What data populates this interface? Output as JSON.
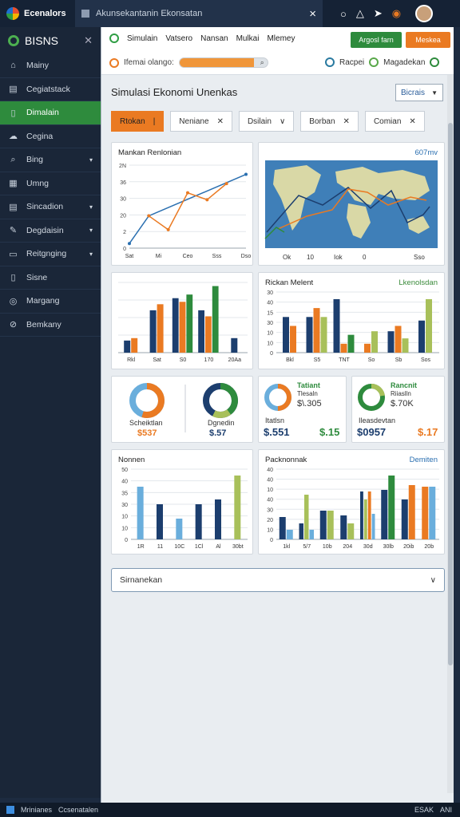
{
  "window": {
    "app_name": "Ecenalors",
    "tab_title": "Akunsekantanin Ekonsatan",
    "close": "×",
    "controls": [
      "⚪",
      "⚠",
      "➤",
      "●"
    ]
  },
  "sidebar": {
    "brand": "BISNS",
    "items": [
      {
        "label": "Mainy",
        "icon": "window-icon",
        "glyph": "⌂",
        "chev": ""
      },
      {
        "label": "Cegiatstack",
        "icon": "table-icon",
        "glyph": "▤",
        "chev": ""
      },
      {
        "label": "Dimalain",
        "icon": "book-icon",
        "glyph": "▯",
        "chev": "",
        "active": true
      },
      {
        "label": "Cegina",
        "icon": "cloud-icon",
        "glyph": "☁",
        "chev": ""
      },
      {
        "label": "Bing",
        "icon": "search-icon",
        "glyph": "⌕",
        "chev": "▾"
      },
      {
        "label": "Umng",
        "icon": "calendar-icon",
        "glyph": "▦",
        "chev": ""
      },
      {
        "label": "Sincadion",
        "icon": "doc-icon",
        "glyph": "▤",
        "chev": "▾"
      },
      {
        "label": "Degdaisin",
        "icon": "pen-icon",
        "glyph": "✎",
        "chev": "▾"
      },
      {
        "label": "Reitgnging",
        "icon": "folder-icon",
        "glyph": "▭",
        "chev": "▾"
      },
      {
        "label": "Sisne",
        "icon": "file-icon",
        "glyph": "▯",
        "chev": ""
      },
      {
        "label": "Margang",
        "icon": "globe-icon",
        "glyph": "◎",
        "chev": ""
      },
      {
        "label": "Bemkany",
        "icon": "check-circle-icon",
        "glyph": "⊘",
        "chev": ""
      }
    ]
  },
  "topbar": {
    "links": [
      "Simulain",
      "Vatsero",
      "Nansan",
      "Mulkai",
      "Mlemey"
    ],
    "btn_green": "Argosl farn",
    "btn_orange": "Meskea",
    "status_label": "Ifemai olango:",
    "progress": 0.85,
    "right_labels": [
      "Racpei",
      "Magadekan"
    ]
  },
  "page": {
    "title": "Simulasi Ekonomi Unenkas",
    "select": "Bicrais"
  },
  "filters": [
    {
      "label": "Rtokan",
      "mark": "|",
      "active": true
    },
    {
      "label": "Neniane",
      "mark": "✕"
    },
    {
      "label": "Dsilain",
      "mark": "∨"
    },
    {
      "label": "Borban",
      "mark": "✕"
    },
    {
      "label": "Comian",
      "mark": "✕"
    }
  ],
  "cards": {
    "line_title": "Mankan Renlonian",
    "map_label": "607mv",
    "bars1_title": "",
    "bars2_title": "Rickan Melent",
    "bars2_right": "Lkenolsdan",
    "donut1_label": "Scheiktlan",
    "donut1_value": "$537",
    "donut2_label": "Dgnedin",
    "donut2_value": "$.57",
    "donut3_title": "Tatiant",
    "donut3_sub": "Tlesaln",
    "donut3_amount": "$\\.305",
    "donut3_label": "Itatlsn",
    "donut3_value_a": "$.551",
    "donut3_value_b": "$.15",
    "donut4_title": "Rancnit",
    "donut4_sub": "Riiaslln",
    "donut4_amount": "$.70K",
    "donut4_label": "Ileasdevtan",
    "donut4_value_a": "$0957",
    "donut4_value_b": "$.17",
    "bars3_title": "Nonnen",
    "bars4_title": "Packnonnak",
    "bars4_right": "Demiten"
  },
  "accordion": "Sirnanekan",
  "taskbar": [
    "Mrinianes",
    "Ccsenatalen",
    "ESAK",
    "ANI"
  ],
  "colors": {
    "green": "#2e8b3d",
    "orange": "#ea7a22",
    "navy": "#1c3e6e",
    "sky": "#6aaedc",
    "olive": "#a8c05a"
  },
  "chart_data": [
    {
      "type": "line",
      "title": "Mankan Renlonian",
      "categories": [
        "Sat",
        "Mi",
        "Ceo",
        "Sss",
        "Dso"
      ],
      "yticks": [
        "0",
        "2",
        "20",
        "30",
        "36",
        "2N"
      ],
      "series": [
        {
          "color": "#2a6fb0",
          "values": [
            2,
            14,
            null,
            null,
            null,
            null,
            32
          ]
        },
        {
          "color": "#ea7a22",
          "values": [
            null,
            14,
            8,
            24,
            21,
            28,
            null
          ]
        }
      ]
    },
    {
      "type": "bar",
      "categories": [
        "Rkl",
        "Sat",
        "S0",
        "170",
        "20Aa"
      ],
      "series": [
        {
          "color": "#1c3e6e",
          "values": [
            10,
            35,
            45,
            35,
            12
          ]
        },
        {
          "color": "#ea7a22",
          "values": [
            12,
            40,
            42,
            30,
            0
          ]
        },
        {
          "color": "#2e8b3d",
          "values": [
            0,
            0,
            48,
            55,
            0
          ]
        }
      ]
    },
    {
      "type": "bar",
      "title": "Rickan Melent",
      "categories": [
        "Bkl",
        "S5",
        "TNT",
        "So",
        "Sb",
        "Sos"
      ],
      "yticks": [
        "0",
        "10",
        "10",
        "30",
        "15",
        "40",
        "30"
      ],
      "series": [
        {
          "color": "#1c3e6e",
          "values": [
            20,
            20,
            30,
            0,
            12,
            18
          ]
        },
        {
          "color": "#ea7a22",
          "values": [
            15,
            25,
            5,
            5,
            15,
            0
          ]
        },
        {
          "color": "#a8c05a",
          "values": [
            0,
            20,
            0,
            12,
            8,
            30
          ]
        },
        {
          "color": "#2e8b3d",
          "values": [
            0,
            0,
            10,
            0,
            0,
            0
          ]
        }
      ]
    },
    {
      "type": "bar",
      "title": "Nonnen",
      "categories": [
        "1R",
        "11",
        "10C",
        "1Cl",
        "Al",
        "30bt"
      ],
      "yticks": [
        "0",
        "10",
        "10",
        "30",
        "35",
        "40",
        "50"
      ],
      "series": [
        {
          "color": "#6aaedc",
          "values": [
            33,
            0,
            13,
            0,
            0,
            0
          ]
        },
        {
          "color": "#1c3e6e",
          "values": [
            0,
            22,
            0,
            22,
            25,
            0
          ]
        },
        {
          "color": "#a8c05a",
          "values": [
            0,
            0,
            0,
            0,
            0,
            40
          ]
        }
      ]
    },
    {
      "type": "bar",
      "title": "Packnonnak",
      "right_label": "Demiten",
      "categories": [
        "1kl",
        "5/7",
        "10b",
        "204",
        "30d",
        "30lb",
        "20ib",
        "20b"
      ],
      "yticks": [
        "0",
        "10",
        "20",
        "30",
        "40",
        "10",
        "40",
        "40"
      ],
      "series": [
        {
          "color": "#1c3e6e",
          "values": [
            14,
            10,
            18,
            15,
            30,
            31,
            25,
            0
          ]
        },
        {
          "color": "#a8c05a",
          "values": [
            0,
            28,
            18,
            10,
            25,
            0,
            0,
            0
          ]
        },
        {
          "color": "#2e8b3d",
          "values": [
            0,
            0,
            0,
            0,
            0,
            40,
            0,
            0
          ]
        },
        {
          "color": "#ea7a22",
          "values": [
            0,
            0,
            0,
            0,
            30,
            0,
            34,
            33
          ]
        },
        {
          "color": "#6aaedc",
          "values": [
            6,
            6,
            0,
            0,
            16,
            0,
            0,
            33
          ]
        }
      ]
    }
  ]
}
